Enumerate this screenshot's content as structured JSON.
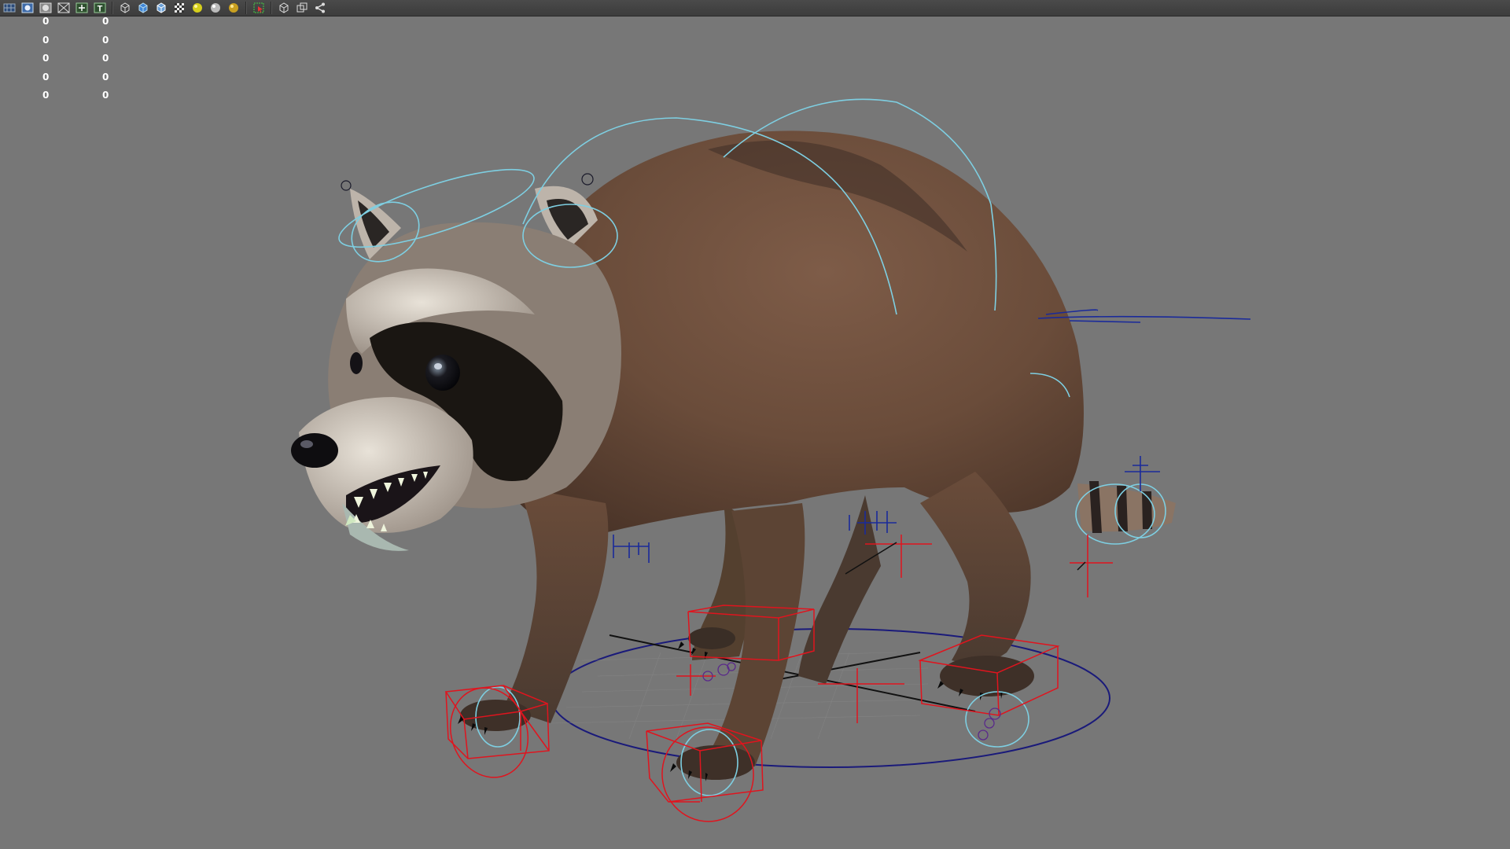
{
  "toolbar": {
    "buttons": [
      {
        "icon": "grid-icon"
      },
      {
        "icon": "camera-icon"
      },
      {
        "icon": "image-plane-icon"
      },
      {
        "icon": "wireframe-icon"
      },
      {
        "icon": "resolution-gate-icon"
      },
      {
        "icon": "text-icon",
        "label": "T"
      },
      {
        "icon": "wireframe-cube-icon"
      },
      {
        "icon": "smooth-shade-icon"
      },
      {
        "icon": "shaded-wireframe-icon"
      },
      {
        "icon": "textured-icon"
      },
      {
        "icon": "default-light-icon"
      },
      {
        "icon": "shadows-icon"
      },
      {
        "icon": "all-lights-icon"
      },
      {
        "icon": "isolate-select-icon"
      },
      {
        "icon": "xray-icon"
      },
      {
        "icon": "xray-joints-icon"
      },
      {
        "icon": "share-icon"
      }
    ]
  },
  "hud": {
    "rows": [
      {
        "a": "0",
        "b": "0"
      },
      {
        "a": "0",
        "b": "0"
      },
      {
        "a": "0",
        "b": "0"
      },
      {
        "a": "0",
        "b": "0"
      },
      {
        "a": "0",
        "b": "0"
      }
    ]
  },
  "viewport": {
    "background": "#777777",
    "subject": "raccoon-model",
    "colors": {
      "nurbs_curve": "#7ecfe2",
      "ik_box": "#e0141e",
      "root_circle": "#1a1a7a",
      "fur_dark": "#5a4030",
      "fur_mid": "#7a5a45",
      "mask": "#1a1612"
    }
  }
}
